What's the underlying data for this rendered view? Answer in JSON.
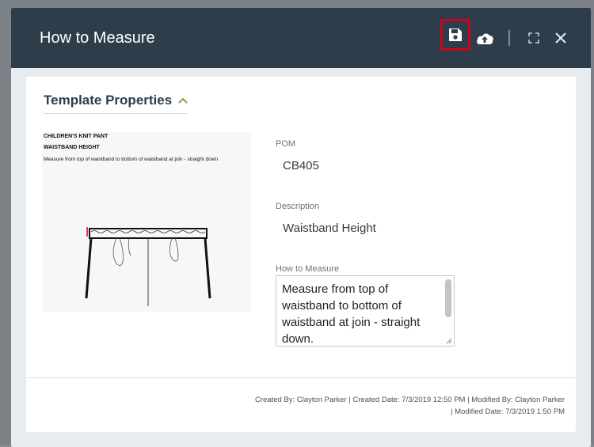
{
  "modal": {
    "title": "How to Measure"
  },
  "toolbar": {
    "save_icon": "save-icon",
    "upload_icon": "cloud-upload-icon",
    "expand_icon": "expand-icon",
    "close_icon": "close-icon"
  },
  "section": {
    "title": "Template Properties",
    "toggle_icon": "chevron-up-icon",
    "accent": "#7aa83b"
  },
  "image": {
    "heading1": "CHILDREN'S KNIT PANT",
    "heading2": "WAISTBAND HEIGHT",
    "description": "Measure from top of waistband to bottom of waistband at join - straight down"
  },
  "fields": {
    "pom_label": "POM",
    "pom_value": "CB405",
    "description_label": "Description",
    "description_value": "Waistband Height",
    "how_to_measure_label": "How to Measure",
    "how_to_measure_value": "Measure from top of waistband to bottom of waistband at join - straight down."
  },
  "meta": {
    "created_by_label": "Created By:",
    "created_by": "Clayton Parker",
    "created_date_label": "Created Date:",
    "created_date": "7/3/2019 12:50 PM",
    "modified_by_label": "Modified By:",
    "modified_by": "Clayton Parker",
    "modified_date_label": "Modified Date:",
    "modified_date": "7/3/2019 1:50 PM"
  },
  "colors": {
    "titlebar": "#2e3d4a",
    "highlight": "#d0021b"
  }
}
